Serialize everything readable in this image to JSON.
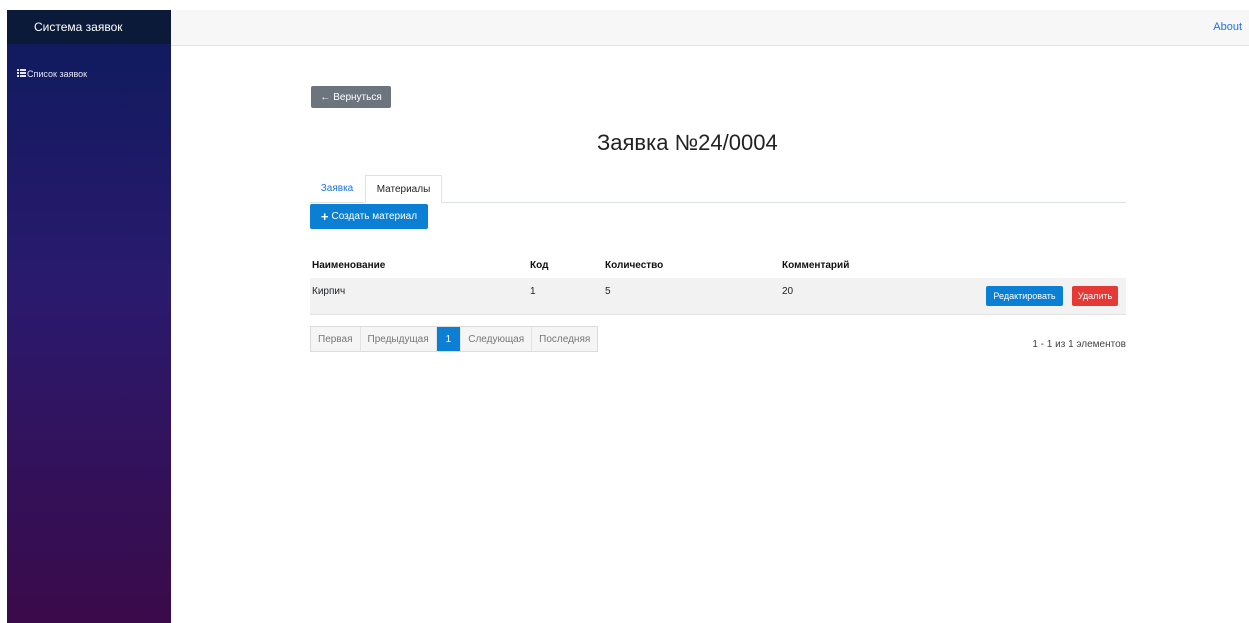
{
  "sidebar": {
    "brand": "Система заявок",
    "items": [
      {
        "icon": "list-icon",
        "label": "Список заявок"
      }
    ]
  },
  "topbar": {
    "about": "About"
  },
  "back_button": {
    "icon": "arrow-left-icon",
    "label": "Вернуться"
  },
  "page": {
    "title": "Заявка №24/0004"
  },
  "tabs": [
    {
      "label": "Заявка",
      "active": false
    },
    {
      "label": "Материалы",
      "active": true
    }
  ],
  "create_button": {
    "icon": "plus-icon",
    "label": "Создать материал"
  },
  "table": {
    "headers": [
      "Наименование",
      "Код",
      "Количество",
      "Комментарий"
    ],
    "rows": [
      {
        "name": "Кирпич",
        "code": "1",
        "quantity": "5",
        "comment": "20",
        "edit_label": "Редактировать",
        "delete_label": "Удалить"
      }
    ]
  },
  "pagination": {
    "first": "Первая",
    "prev": "Предыдущая",
    "current": "1",
    "next": "Следующая",
    "last": "Последняя",
    "info": "1 - 1 из 1 элементов"
  },
  "colors": {
    "primary": "#0a7fd4",
    "danger": "#e53935",
    "secondary": "#6c757d",
    "sidebar_top": "#0d1b5c",
    "sidebar_bottom": "#3a0a4a"
  }
}
